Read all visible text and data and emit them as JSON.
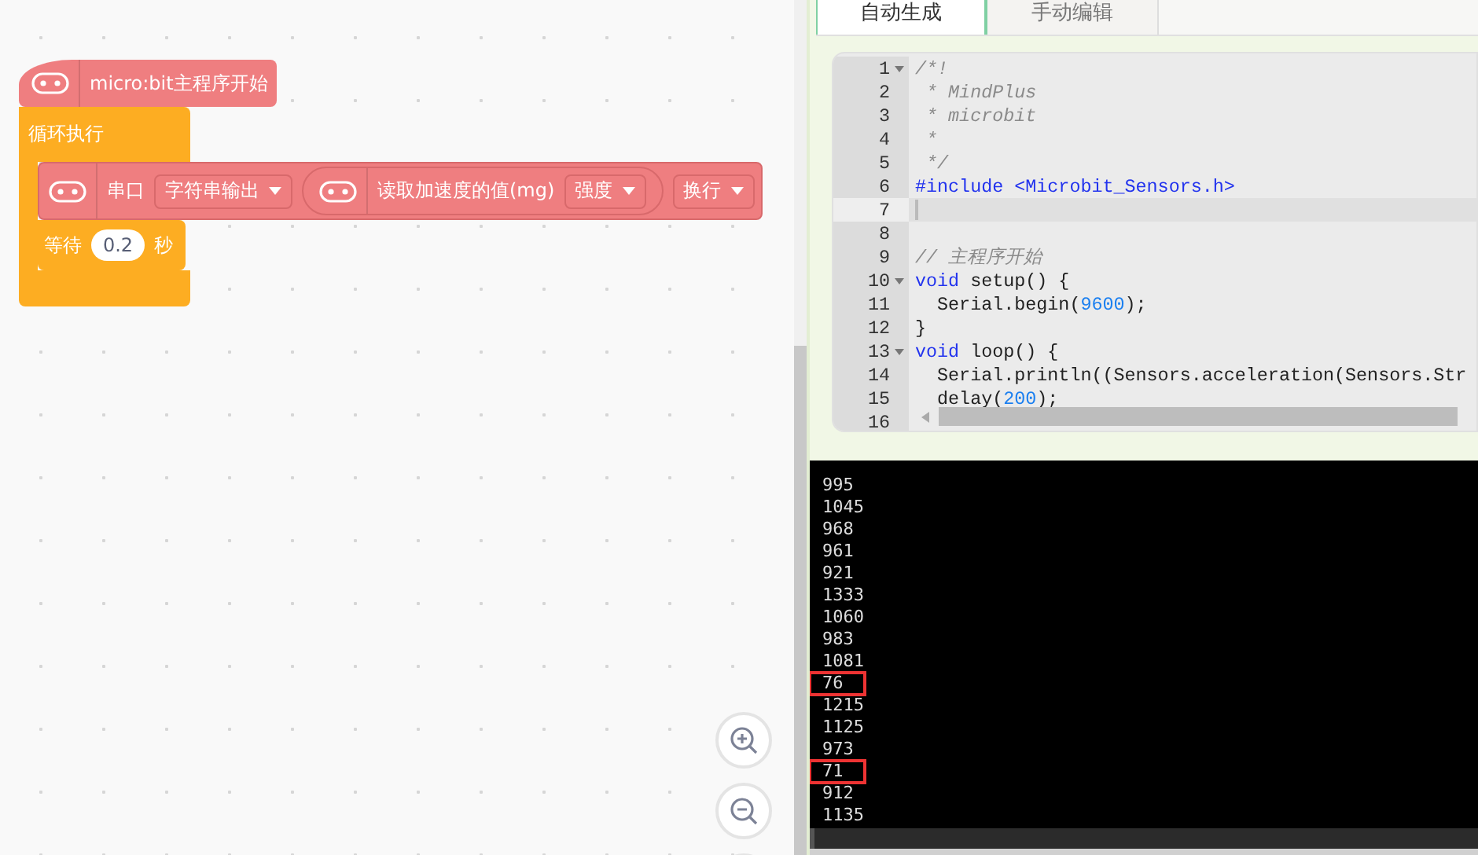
{
  "blocks": {
    "hat": {
      "label": "micro:bit主程序开始"
    },
    "loop": {
      "label": "循环执行"
    },
    "serial": {
      "label": "串口",
      "mode": "字符串输出",
      "reporter": {
        "label": "读取加速度的值(mg)",
        "option": "强度"
      },
      "ending": "换行"
    },
    "wait": {
      "label": "等待",
      "value": "0.2",
      "unit": "秒"
    }
  },
  "tabs": [
    {
      "label": "自动生成",
      "selected": true
    },
    {
      "label": "手动编辑",
      "selected": false
    }
  ],
  "code_lines": [
    {
      "number": "1",
      "fold": true,
      "current": false,
      "segments": [
        {
          "kind": "comment",
          "text": "/*!"
        }
      ]
    },
    {
      "number": "2",
      "fold": false,
      "current": false,
      "segments": [
        {
          "kind": "comment",
          "text": " * MindPlus"
        }
      ]
    },
    {
      "number": "3",
      "fold": false,
      "current": false,
      "segments": [
        {
          "kind": "comment",
          "text": " * microbit"
        }
      ]
    },
    {
      "number": "4",
      "fold": false,
      "current": false,
      "segments": [
        {
          "kind": "comment",
          "text": " *"
        }
      ]
    },
    {
      "number": "5",
      "fold": false,
      "current": false,
      "segments": [
        {
          "kind": "comment",
          "text": " */"
        }
      ]
    },
    {
      "number": "6",
      "fold": false,
      "current": false,
      "segments": [
        {
          "kind": "keyword",
          "text": "#include"
        },
        {
          "kind": "string",
          "text": " <Microbit_Sensors.h>"
        }
      ]
    },
    {
      "number": "7",
      "fold": false,
      "current": true
    },
    {
      "number": "8",
      "fold": false,
      "current": false
    },
    {
      "number": "9",
      "fold": false,
      "current": false,
      "segments": [
        {
          "kind": "comment",
          "text": "// 主程序开始"
        }
      ]
    },
    {
      "number": "10",
      "fold": true,
      "current": false,
      "segments": [
        {
          "kind": "keyword",
          "text": "void"
        },
        {
          "kind": "plain",
          "text": " setup() {"
        }
      ]
    },
    {
      "number": "11",
      "fold": false,
      "current": false,
      "segments": [
        {
          "kind": "plain",
          "text": "  Serial.begin("
        },
        {
          "kind": "number",
          "text": "9600"
        },
        {
          "kind": "plain",
          "text": ");"
        }
      ]
    },
    {
      "number": "12",
      "fold": false,
      "current": false,
      "segments": [
        {
          "kind": "plain",
          "text": "}"
        }
      ]
    },
    {
      "number": "13",
      "fold": true,
      "current": false,
      "segments": [
        {
          "kind": "keyword",
          "text": "void"
        },
        {
          "kind": "plain",
          "text": " loop() {"
        }
      ]
    },
    {
      "number": "14",
      "fold": false,
      "current": false,
      "segments": [
        {
          "kind": "plain",
          "text": "  Serial.println((Sensors.acceleration(Sensors.Str"
        }
      ]
    },
    {
      "number": "15",
      "fold": false,
      "current": false,
      "segments": [
        {
          "kind": "plain",
          "text": "  delay("
        },
        {
          "kind": "number",
          "text": "200"
        },
        {
          "kind": "plain",
          "text": ");"
        }
      ]
    },
    {
      "number": "16",
      "fold": false,
      "current": false
    }
  ],
  "serial_output": [
    {
      "text": "995",
      "highlighted": false
    },
    {
      "text": "1045",
      "highlighted": false
    },
    {
      "text": "968",
      "highlighted": false
    },
    {
      "text": "961",
      "highlighted": false
    },
    {
      "text": "921",
      "highlighted": false
    },
    {
      "text": "1333",
      "highlighted": false
    },
    {
      "text": "1060",
      "highlighted": false
    },
    {
      "text": "983",
      "highlighted": false
    },
    {
      "text": "1081",
      "highlighted": false
    },
    {
      "text": "76",
      "highlighted": true
    },
    {
      "text": "1215",
      "highlighted": false
    },
    {
      "text": "1125",
      "highlighted": false
    },
    {
      "text": "973",
      "highlighted": false
    },
    {
      "text": "71",
      "highlighted": true
    },
    {
      "text": "912",
      "highlighted": false
    },
    {
      "text": "1135",
      "highlighted": false
    }
  ]
}
